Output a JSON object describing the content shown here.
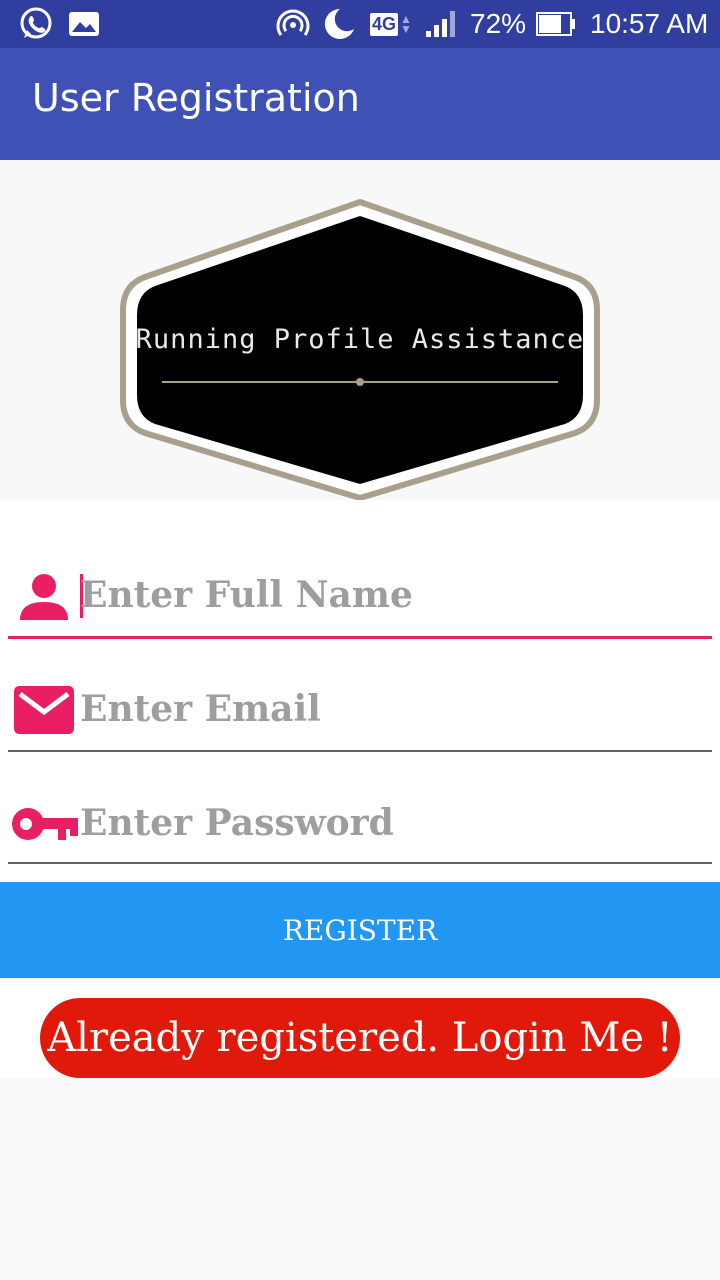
{
  "status_bar": {
    "battery": "72%",
    "time": "10:57 AM",
    "network": "4G",
    "icons": [
      "whatsapp-icon",
      "gallery-icon",
      "hotspot-icon",
      "moon-icon",
      "network-4g-icon",
      "signal-icon",
      "battery-icon"
    ]
  },
  "app_bar": {
    "title": "User Registration",
    "color": "#3f51b5"
  },
  "logo": {
    "text": "Running Profile Assistance"
  },
  "form": {
    "full_name": {
      "placeholder": "Enter Full Name",
      "value": "",
      "icon": "person-icon",
      "focused": true
    },
    "email": {
      "placeholder": "Enter Email",
      "value": "",
      "icon": "email-icon"
    },
    "password": {
      "placeholder": "Enter Password",
      "value": "",
      "icon": "key-icon"
    },
    "accent_color": "#e91e63"
  },
  "register_button": {
    "label": "REGISTER",
    "color": "#2196f3"
  },
  "login_button": {
    "label": "Already registered. Login Me !",
    "color": "#e0190a"
  }
}
